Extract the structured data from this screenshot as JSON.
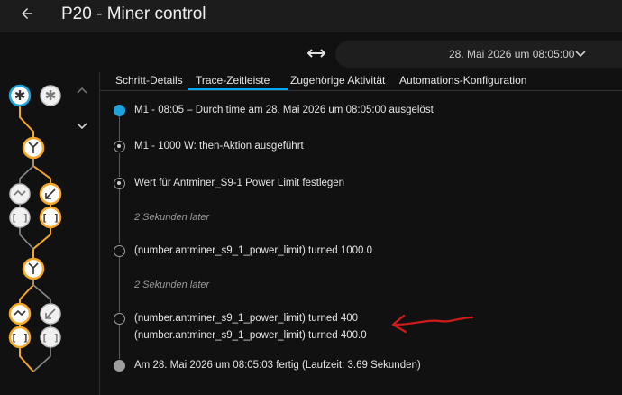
{
  "header": {
    "title": "P20 - Miner control"
  },
  "toolbar": {
    "date_value": "28. Mai 2026 um 08:05:00"
  },
  "tabs": [
    {
      "label": "Schritt-Details"
    },
    {
      "label": "Trace-Zeitleiste"
    },
    {
      "label": "Zugehörige Aktivität"
    },
    {
      "label": "Automations-Konfiguration"
    }
  ],
  "active_tab_index": 1,
  "timeline": [
    {
      "text": "M1 - 08:05 – Durch time am 28. Mai 2026 um 08:05:00 ausgelöst"
    },
    {
      "text": "M1 - 1000 W: then-Aktion ausgeführt"
    },
    {
      "text": "Wert für Antminer_S9-1 Power Limit festlegen"
    },
    {
      "text": "2 Sekunden later"
    },
    {
      "text": "(number.antminer_s9_1_power_limit) turned 1000.0"
    },
    {
      "text": "2 Sekunden later"
    },
    {
      "text": "(number.antminer_s9_1_power_limit) turned 400"
    },
    {
      "text": "(number.antminer_s9_1_power_limit) turned 400.0"
    },
    {
      "text": "Am 28. Mai 2026 um 08:05:03 fertig (Laufzeit: 3.69 Sekunden)"
    }
  ],
  "colors": {
    "accent": "#03a9f4",
    "trigger_node": "#1fa3dc",
    "active_path": "#f5a623",
    "inactive_node": "#bdbdbd",
    "annotation": "#d11a1a"
  }
}
